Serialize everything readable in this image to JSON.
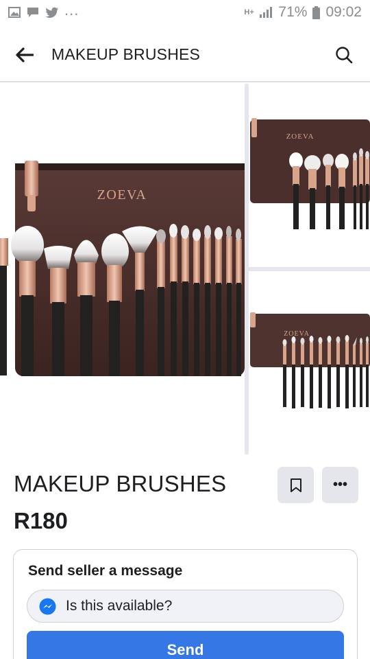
{
  "status_bar": {
    "overflow_dots": "...",
    "network": "H+",
    "battery": "71%",
    "time": "09:02",
    "icons": [
      "image-icon",
      "chat-icon",
      "twitter-icon",
      "signal-icon",
      "battery-icon"
    ]
  },
  "nav": {
    "title": "MAKEUP BRUSHES",
    "back_icon": "arrow-left-icon",
    "search_icon": "search-icon"
  },
  "gallery": {
    "photos": [
      {
        "brand": "ZOEVA",
        "pouch_tag": "ZOEVA"
      },
      {
        "brand": "ZOEVA"
      },
      {
        "brand": "ZOEVA"
      }
    ]
  },
  "listing": {
    "title": "MAKEUP BRUSHES",
    "price": "R180",
    "save_icon": "bookmark-icon",
    "more_label": "•••"
  },
  "message": {
    "heading": "Send seller a message",
    "input_value": "Is this available?",
    "send_label": "Send",
    "messenger_icon": "messenger-icon"
  },
  "colors": {
    "accent": "#3578e5",
    "pouch": "#4a2f2c",
    "rose_gold": "#d9a48c",
    "gray_text": "#8a8d91"
  }
}
